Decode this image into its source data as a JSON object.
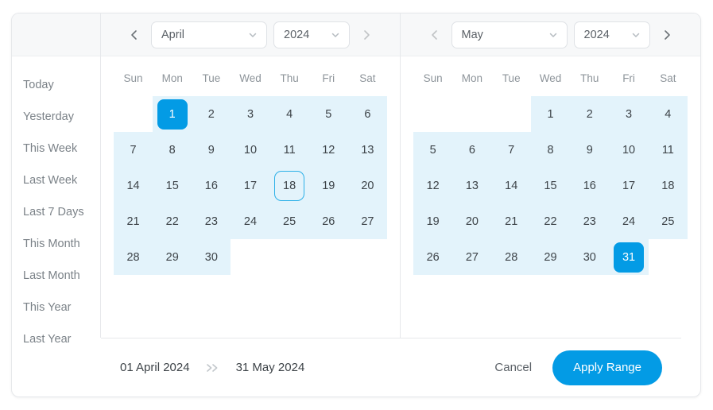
{
  "sidebar": {
    "presets": [
      {
        "label": "Today"
      },
      {
        "label": "Yesterday"
      },
      {
        "label": "This Week"
      },
      {
        "label": "Last Week"
      },
      {
        "label": "Last 7 Days"
      },
      {
        "label": "This Month"
      },
      {
        "label": "Last Month"
      },
      {
        "label": "This Year"
      },
      {
        "label": "Last Year"
      }
    ]
  },
  "colors": {
    "accent": "#039be5",
    "range_fill": "#e3f3fb",
    "today_outline": "#2cb0e8",
    "header_bg": "#f7f8f9",
    "border": "#e6e8eb"
  },
  "weekdays": [
    "Sun",
    "Mon",
    "Tue",
    "Wed",
    "Thu",
    "Fri",
    "Sat"
  ],
  "months": [
    {
      "id": "left",
      "month": "April",
      "year": "2024",
      "prev_enabled": true,
      "next_enabled": false,
      "lead_blanks": 1,
      "days": [
        {
          "n": "1",
          "state": "selected-start"
        },
        {
          "n": "2",
          "state": "in-range"
        },
        {
          "n": "3",
          "state": "in-range"
        },
        {
          "n": "4",
          "state": "in-range"
        },
        {
          "n": "5",
          "state": "in-range"
        },
        {
          "n": "6",
          "state": "in-range"
        },
        {
          "n": "7",
          "state": "in-range"
        },
        {
          "n": "8",
          "state": "in-range"
        },
        {
          "n": "9",
          "state": "in-range"
        },
        {
          "n": "10",
          "state": "in-range"
        },
        {
          "n": "11",
          "state": "in-range"
        },
        {
          "n": "12",
          "state": "in-range"
        },
        {
          "n": "13",
          "state": "in-range"
        },
        {
          "n": "14",
          "state": "in-range"
        },
        {
          "n": "15",
          "state": "in-range"
        },
        {
          "n": "16",
          "state": "in-range"
        },
        {
          "n": "17",
          "state": "in-range"
        },
        {
          "n": "18",
          "state": "in-range-today"
        },
        {
          "n": "19",
          "state": "in-range"
        },
        {
          "n": "20",
          "state": "in-range"
        },
        {
          "n": "21",
          "state": "in-range"
        },
        {
          "n": "22",
          "state": "in-range"
        },
        {
          "n": "23",
          "state": "in-range"
        },
        {
          "n": "24",
          "state": "in-range"
        },
        {
          "n": "25",
          "state": "in-range"
        },
        {
          "n": "26",
          "state": "in-range"
        },
        {
          "n": "27",
          "state": "in-range"
        },
        {
          "n": "28",
          "state": "in-range"
        },
        {
          "n": "29",
          "state": "in-range"
        },
        {
          "n": "30",
          "state": "in-range"
        }
      ]
    },
    {
      "id": "right",
      "month": "May",
      "year": "2024",
      "prev_enabled": false,
      "next_enabled": true,
      "lead_blanks": 3,
      "days": [
        {
          "n": "1",
          "state": "in-range"
        },
        {
          "n": "2",
          "state": "in-range"
        },
        {
          "n": "3",
          "state": "in-range"
        },
        {
          "n": "4",
          "state": "in-range"
        },
        {
          "n": "5",
          "state": "in-range"
        },
        {
          "n": "6",
          "state": "in-range"
        },
        {
          "n": "7",
          "state": "in-range"
        },
        {
          "n": "8",
          "state": "in-range"
        },
        {
          "n": "9",
          "state": "in-range"
        },
        {
          "n": "10",
          "state": "in-range"
        },
        {
          "n": "11",
          "state": "in-range"
        },
        {
          "n": "12",
          "state": "in-range"
        },
        {
          "n": "13",
          "state": "in-range"
        },
        {
          "n": "14",
          "state": "in-range"
        },
        {
          "n": "15",
          "state": "in-range"
        },
        {
          "n": "16",
          "state": "in-range"
        },
        {
          "n": "17",
          "state": "in-range"
        },
        {
          "n": "18",
          "state": "in-range"
        },
        {
          "n": "19",
          "state": "in-range"
        },
        {
          "n": "20",
          "state": "in-range"
        },
        {
          "n": "21",
          "state": "in-range"
        },
        {
          "n": "22",
          "state": "in-range"
        },
        {
          "n": "23",
          "state": "in-range"
        },
        {
          "n": "24",
          "state": "in-range"
        },
        {
          "n": "25",
          "state": "in-range"
        },
        {
          "n": "26",
          "state": "in-range"
        },
        {
          "n": "27",
          "state": "in-range"
        },
        {
          "n": "28",
          "state": "in-range"
        },
        {
          "n": "29",
          "state": "in-range"
        },
        {
          "n": "30",
          "state": "in-range"
        },
        {
          "n": "31",
          "state": "selected-end"
        }
      ]
    }
  ],
  "footer": {
    "start_date": "01 April 2024",
    "separator": "»",
    "end_date": "31 May 2024",
    "cancel_label": "Cancel",
    "apply_label": "Apply Range"
  }
}
